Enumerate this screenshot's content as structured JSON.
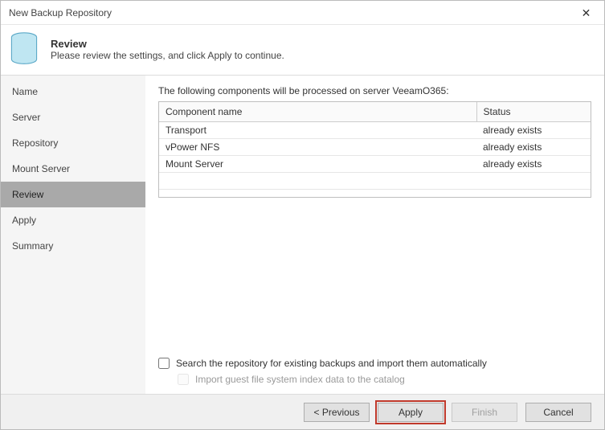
{
  "window": {
    "title": "New Backup Repository"
  },
  "header": {
    "heading": "Review",
    "subheading": "Please review the settings, and click Apply to continue."
  },
  "sidebar": {
    "items": [
      {
        "label": "Name"
      },
      {
        "label": "Server"
      },
      {
        "label": "Repository"
      },
      {
        "label": "Mount Server"
      },
      {
        "label": "Review"
      },
      {
        "label": "Apply"
      },
      {
        "label": "Summary"
      }
    ],
    "activeIndex": 4
  },
  "main": {
    "intro": "The following components will be processed on server VeeamO365:",
    "table": {
      "cols": [
        "Component name",
        "Status"
      ],
      "rows": [
        {
          "name": "Transport",
          "status": "already exists"
        },
        {
          "name": "vPower NFS",
          "status": "already exists"
        },
        {
          "name": "Mount Server",
          "status": "already exists"
        }
      ]
    },
    "check_search": "Search the repository for existing backups and import them automatically",
    "check_import": "Import guest file system index data to the catalog"
  },
  "footer": {
    "previous": "<  Previous",
    "apply": "Apply",
    "finish": "Finish",
    "cancel": "Cancel"
  }
}
